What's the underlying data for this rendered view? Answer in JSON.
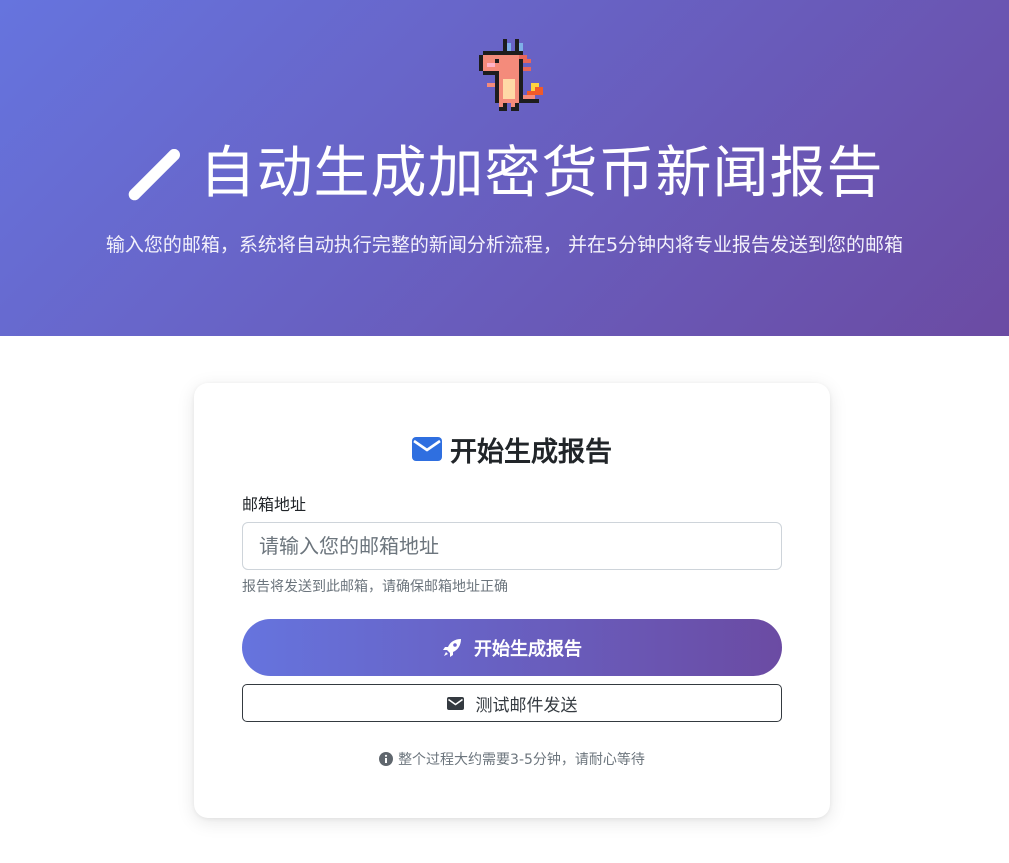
{
  "hero": {
    "title": "自动生成加密货币新闻报告",
    "subtitle": "输入您的邮箱，系统将自动执行完整的新闻分析流程， 并在5分钟内将专业报告发送到您的邮箱",
    "title_icon": "magic-wand-icon",
    "mascot_icon": "pixel-dragon-mascot"
  },
  "form": {
    "title": "开始生成报告",
    "title_icon": "envelope-icon",
    "email_label": "邮箱地址",
    "email_placeholder": "请输入您的邮箱地址",
    "email_value": "",
    "email_help": "报告将发送到此邮箱，请确保邮箱地址正确",
    "submit_label": "开始生成报告",
    "submit_icon": "rocket-icon",
    "test_label": "测试邮件发送",
    "test_icon": "envelope-icon",
    "note": "整个过程大约需要3-5分钟，请耐心等待",
    "note_icon": "info-circle-icon"
  },
  "colors": {
    "gradient_start": "#6674de",
    "gradient_end": "#6b4ba3",
    "accent_blue": "#2f6fe0"
  }
}
